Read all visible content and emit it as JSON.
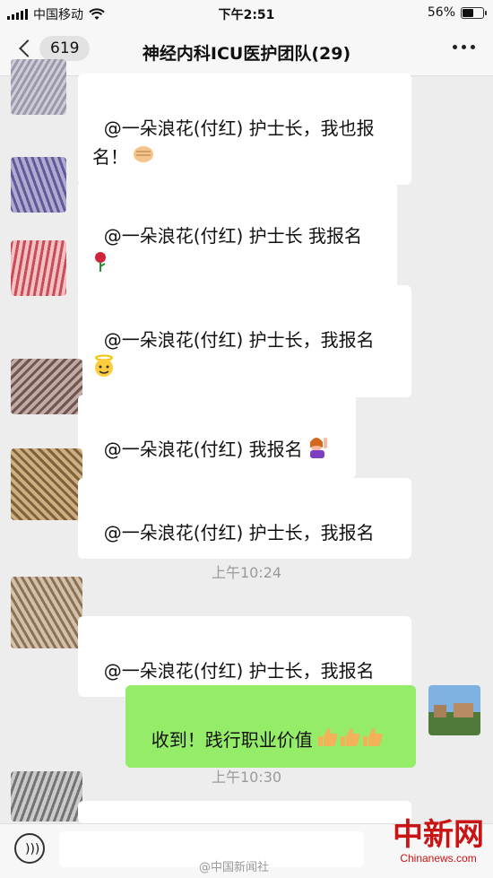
{
  "status_bar": {
    "carrier": "中国移动",
    "time": "下午2:51",
    "battery": "56%",
    "battery_level": 0.56
  },
  "nav": {
    "unread_count": "619",
    "title": "神经内科ICU医护团队(29)"
  },
  "messages": [
    {
      "text": "@一朵浪花(付红) 护士长，我也报\n名！",
      "emoji": "fist-emoji"
    },
    {
      "text": "@一朵浪花(付红) 护士长 我报名",
      "emoji": "rose-emoji"
    },
    {
      "text": "@一朵浪花(付红) 护士长，我报名",
      "emoji": "angel-face-emoji"
    },
    {
      "text": "@一朵浪花(付红) 我报名",
      "emoji": "raising-hand-emoji"
    },
    {
      "text": "@一朵浪花(付红) 护士长，我报名",
      "emoji": ""
    },
    {
      "text": "@一朵浪花(付红) 护士长，我报名",
      "emoji": ""
    }
  ],
  "timestamps": [
    "上午10:24",
    "上午10:30"
  ],
  "sent_message": {
    "text": "收到！践行职业价值",
    "emoji": "thumbs-up-emoji x3"
  },
  "watermark": {
    "logo_text": "中新网",
    "site": "Chinanews.com",
    "weibo_handle": "@中国新闻社"
  },
  "colors": {
    "background": "#ededed",
    "sent_bubble": "#95ec69",
    "watermark": "#c81414"
  }
}
